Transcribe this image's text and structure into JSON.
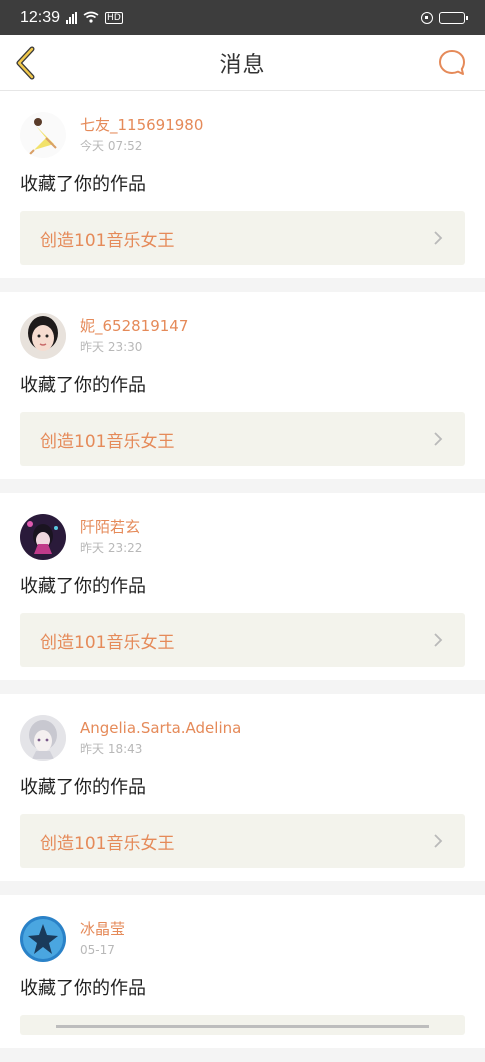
{
  "status_bar": {
    "time": "12:39",
    "network": "4G",
    "hd": "HD"
  },
  "nav": {
    "title": "消息",
    "back_icon": "chevron-left-icon",
    "chat_icon": "chat-bubble-icon",
    "accent": "#e58a59"
  },
  "messages": [
    {
      "user": "七友_115691980",
      "time": "今天 07:52",
      "action": "收藏了你的作品",
      "work": "创造101音乐女王",
      "avatar": "dancer-avatar"
    },
    {
      "user": "妮_652819147",
      "time": "昨天 23:30",
      "action": "收藏了你的作品",
      "work": "创造101音乐女王",
      "avatar": "girl-avatar"
    },
    {
      "user": "阡陌若玄",
      "time": "昨天 23:22",
      "action": "收藏了你的作品",
      "work": "创造101音乐女王",
      "avatar": "anime-avatar"
    },
    {
      "user": "Angelia.Sarta.Adelina",
      "time": "昨天 18:43",
      "action": "收藏了你的作品",
      "work": "创造101音乐女王",
      "avatar": "silver-hair-avatar"
    },
    {
      "user": "冰晶莹",
      "time": "05-17",
      "action": "收藏了你的作品",
      "work": "",
      "avatar": "blue-star-avatar"
    }
  ]
}
